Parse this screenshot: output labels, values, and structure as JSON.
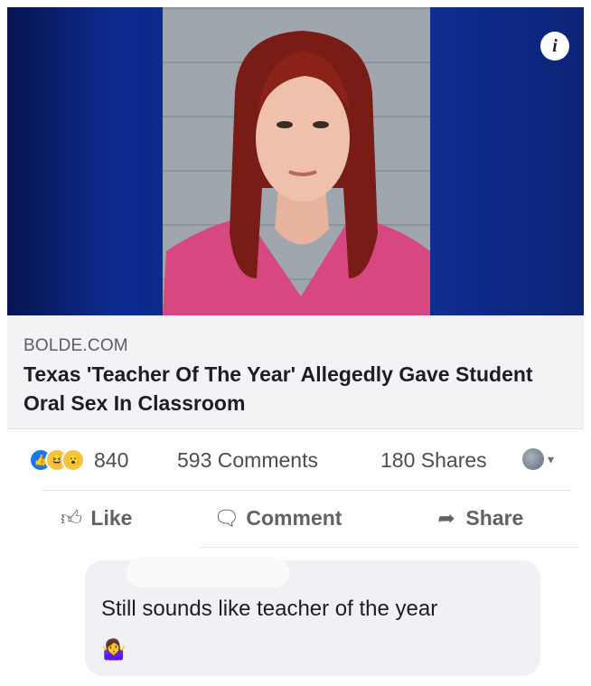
{
  "link": {
    "domain": "BOLDE.COM",
    "headline": "Texas 'Teacher Of The Year' Allegedly Gave Student Oral Sex In Classroom",
    "info_icon": "i"
  },
  "stats": {
    "reaction_count": "840",
    "comments": "593 Comments",
    "shares": "180 Shares",
    "reactions": [
      "like",
      "haha",
      "wow"
    ]
  },
  "actions": {
    "like": "Like",
    "comment": "Comment",
    "share": "Share"
  },
  "comment": {
    "text": "Still sounds like teacher of the year",
    "emoji": "🤷‍♀️"
  },
  "colors": {
    "like_blue": "#1877f2",
    "reaction_yellow": "#f7c33f",
    "meta_bg": "#f2f3f5",
    "comment_bg": "#f0f1f4"
  }
}
